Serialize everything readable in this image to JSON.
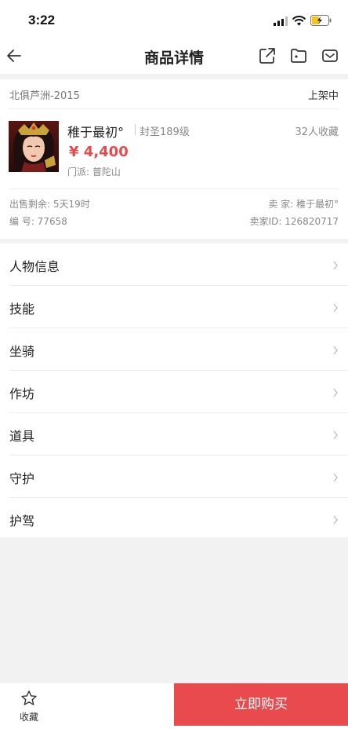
{
  "status_bar": {
    "time": "3:22"
  },
  "nav": {
    "title": "商品详情",
    "icons": [
      "back-arrow-icon",
      "share-icon",
      "folder-icon",
      "mail-icon"
    ]
  },
  "listing": {
    "server": "北俱芦洲-2015",
    "status": "上架中",
    "role_name": "稚于最初°",
    "role_level": "封圣189级",
    "favorites": "32人收藏",
    "price": "¥ 4,400",
    "sect": "门派: 普陀山",
    "time_remaining": "出售剩余: 5天19时",
    "item_number": "编 号: 77658",
    "seller": "卖 家: 稚于最初°",
    "seller_id": "卖家ID: 126820717"
  },
  "menu": [
    {
      "label": "人物信息"
    },
    {
      "label": "技能"
    },
    {
      "label": "坐骑"
    },
    {
      "label": "作坊"
    },
    {
      "label": "道具"
    },
    {
      "label": "守护"
    },
    {
      "label": "护驾"
    }
  ],
  "bottom": {
    "favorite_label": "收藏",
    "buy_label": "立即购买"
  },
  "colors": {
    "accent": "#e84a4d",
    "price": "#e24c4c",
    "battery": "#f5c518"
  }
}
